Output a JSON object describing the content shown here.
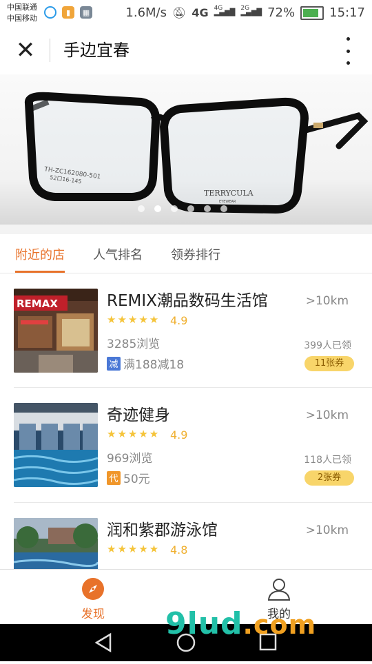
{
  "status_bar": {
    "carrier1": "中国联通",
    "carrier2": "中国移动",
    "speed": "1.6M/s",
    "net1": "4G",
    "net2": "4G",
    "net3": "2G",
    "battery": "72%",
    "battery_level": 0.72,
    "time": "15:17"
  },
  "header": {
    "close_icon": "close-icon",
    "title": "手边宜春",
    "more_icon": "more-icon"
  },
  "banner": {
    "frame_text": "TH-ZC162080-501",
    "frame_size": "52口16-145",
    "brand": "TERRYCULA",
    "brand_sub": "EYEWEAR",
    "active_dot": 1,
    "dot_count": 6
  },
  "tabs": [
    {
      "label": "附近的店",
      "active": true
    },
    {
      "label": "人气排名",
      "active": false
    },
    {
      "label": "领券排行",
      "active": false
    }
  ],
  "shops": [
    {
      "name": "REMIX潮品数码生活馆",
      "distance": ">10km",
      "stars": "★★★★★",
      "rating": "4.9",
      "views": "3285浏览",
      "promo_badge": "减",
      "promo_color": "#4a78d6",
      "promo_text": "满188减18",
      "claimed": "399人已领",
      "coupon": "11张券",
      "thumb_label": "REMAX"
    },
    {
      "name": "奇迹健身",
      "distance": ">10km",
      "stars": "★★★★★",
      "rating": "4.9",
      "views": "969浏览",
      "promo_badge": "代",
      "promo_color": "#f0962a",
      "promo_text": "50元",
      "claimed": "118人已领",
      "coupon": "2张券"
    },
    {
      "name": "润和紫郡游泳馆",
      "distance": ">10km",
      "stars": "★★★★★",
      "rating": "4.8"
    }
  ],
  "tabbar": {
    "discover_label": "发现",
    "discover_icon": "compass-icon",
    "mine_label": "我的",
    "mine_icon": "user-icon",
    "accent": "#e8722a"
  },
  "watermark": {
    "main": "9lud",
    "suffix": ".com"
  }
}
